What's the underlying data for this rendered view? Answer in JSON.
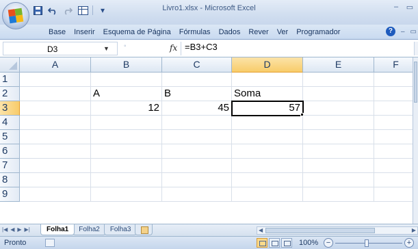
{
  "window": {
    "title": "Livro1.xlsx - Microsoft Excel",
    "controls": {
      "minimize": "–",
      "maximize": "▭",
      "close": "✕"
    }
  },
  "quick_access": {
    "save_icon": "save-icon",
    "undo_icon": "undo-icon",
    "redo_icon": "redo-icon",
    "customize": "▾"
  },
  "ribbon": {
    "tabs": [
      "Base",
      "Inserir",
      "Esquema de Página",
      "Fórmulas",
      "Dados",
      "Rever",
      "Ver",
      "Programador"
    ],
    "help": "?",
    "minimize": "–",
    "restore": "▭"
  },
  "formula_bar": {
    "name_box": "D3",
    "fx": "fx",
    "formula": "=B3+C3"
  },
  "sheet": {
    "columns": [
      "A",
      "B",
      "C",
      "D",
      "E",
      "F"
    ],
    "rows": [
      "1",
      "2",
      "3",
      "4",
      "5",
      "6",
      "7",
      "8",
      "9"
    ],
    "active_cell": "D3",
    "cells": {
      "B2": "A",
      "C2": "B",
      "D2": "Soma",
      "B3": "12",
      "C3": "45",
      "D3": "57"
    }
  },
  "sheet_tabs": [
    "Folha1",
    "Folha2",
    "Folha3"
  ],
  "status": {
    "text": "Pronto",
    "zoom": "100%",
    "zoom_minus": "−",
    "zoom_plus": "+"
  },
  "colors": {
    "accent": "#c8d7ec",
    "selected_header": "#f8cc6a",
    "grid_line": "#d8dfe9"
  }
}
